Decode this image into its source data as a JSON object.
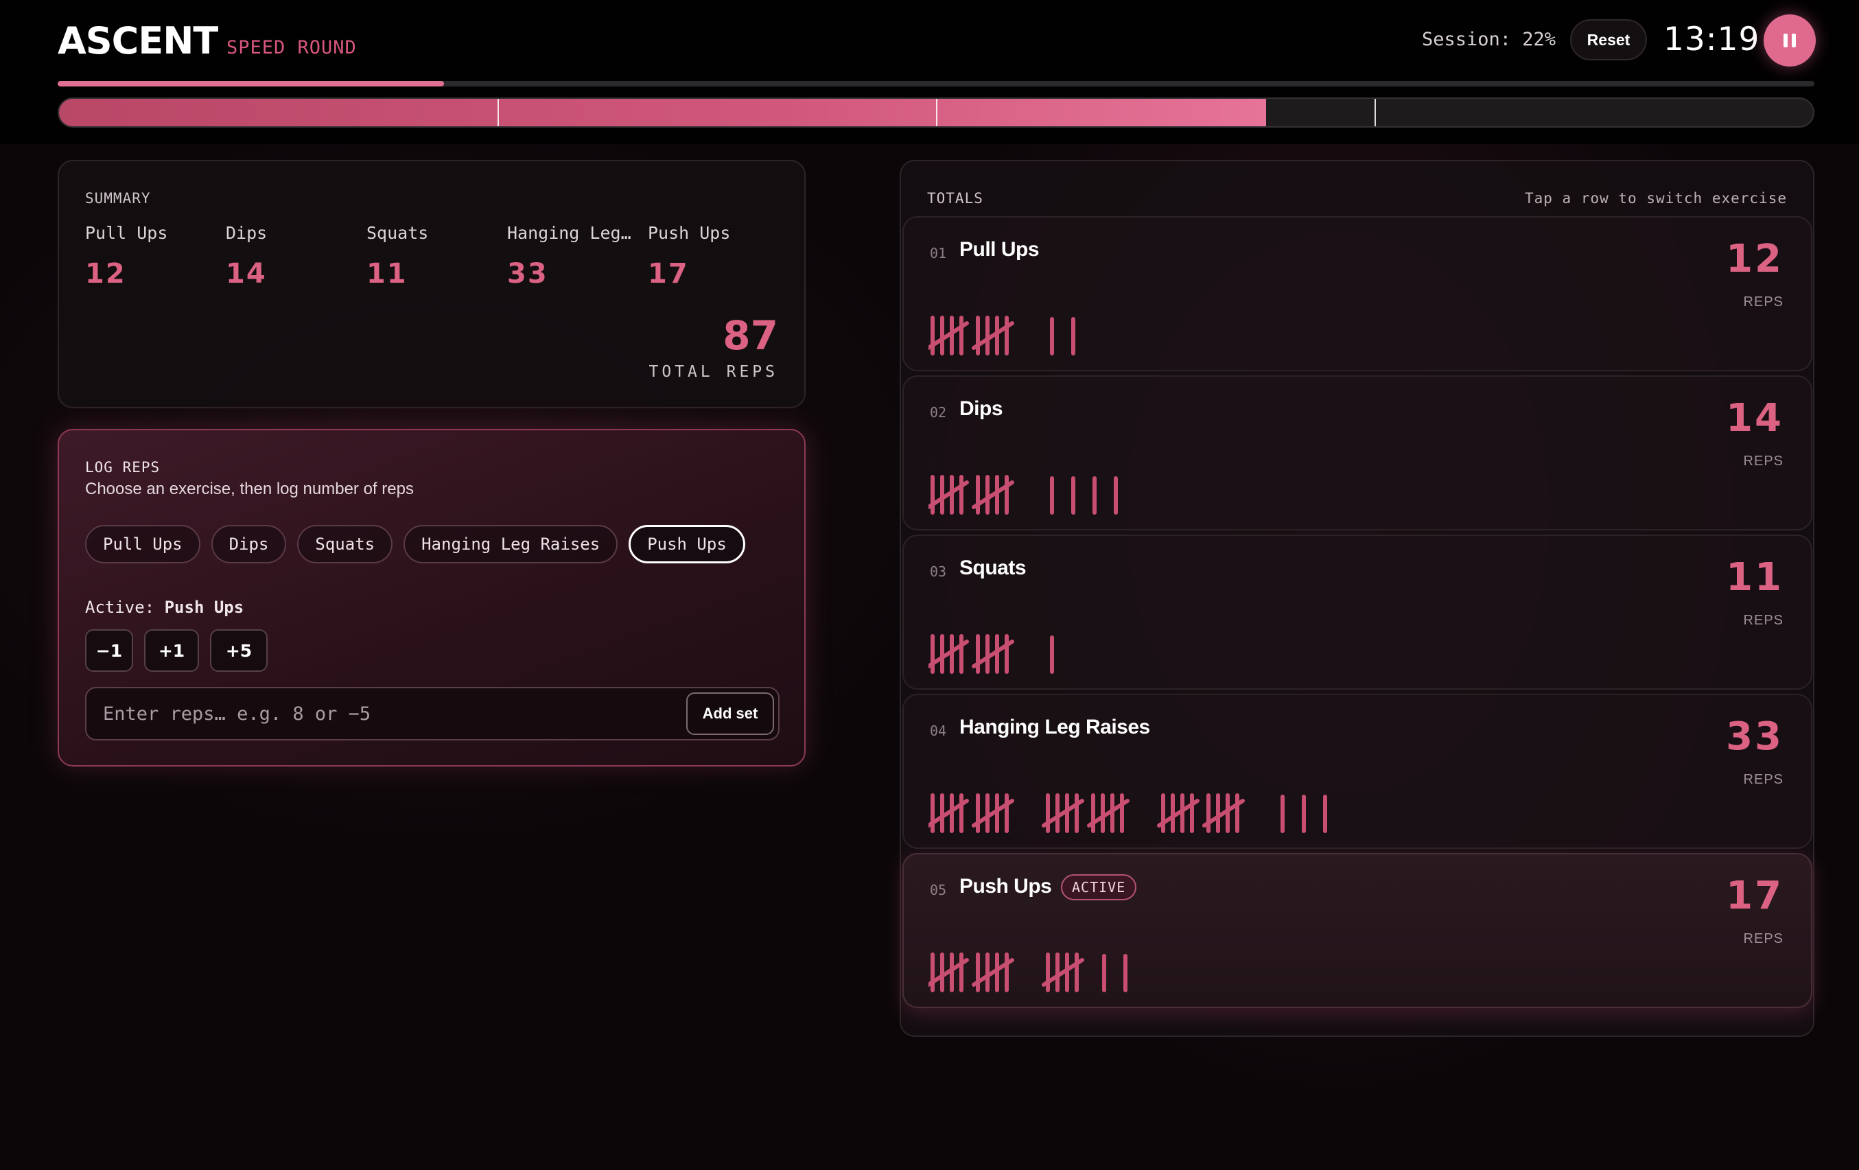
{
  "header": {
    "brand": "ASCENT",
    "mode": "SPEED ROUND",
    "session_text": "Session: 22%",
    "session_progress": 0.22,
    "reset_label": "Reset",
    "clock": "13:19",
    "pause_icon": "pause-icon"
  },
  "segment_bar": {
    "fill_fraction": 0.688,
    "segments": 4,
    "colors": {
      "fill_start": "#b94766",
      "fill_end": "#e67498"
    }
  },
  "summary": {
    "title": "SUMMARY",
    "items": [
      {
        "name": "Pull Ups",
        "value": "12"
      },
      {
        "name": "Dips",
        "value": "14"
      },
      {
        "name": "Squats",
        "value": "11"
      },
      {
        "name": "Hanging Leg …",
        "value": "33"
      },
      {
        "name": "Push Ups",
        "value": "17"
      }
    ],
    "total": "87",
    "total_label": "TOTAL REPS"
  },
  "log": {
    "title": "LOG REPS",
    "subtitle": "Choose an exercise, then log number of reps",
    "pills": [
      "Pull Ups",
      "Dips",
      "Squats",
      "Hanging Leg Raises",
      "Push Ups"
    ],
    "active_pill_index": 4,
    "active_label": "Active:",
    "active_value": "Push Ups",
    "steps": [
      "−1",
      "+1",
      "+5"
    ],
    "input_placeholder": "Enter reps… e.g. 8 or −5",
    "input_value": "",
    "add_label": "Add set"
  },
  "totals": {
    "title": "TOTALS",
    "hint": "Tap a row to switch exercise",
    "reps_label": "REPS",
    "active_badge": "ACTIVE",
    "rows": [
      {
        "num": "01",
        "name": "Pull Ups",
        "count": "12",
        "reps": 12,
        "active": false
      },
      {
        "num": "02",
        "name": "Dips",
        "count": "14",
        "reps": 14,
        "active": false
      },
      {
        "num": "03",
        "name": "Squats",
        "count": "11",
        "reps": 11,
        "active": false
      },
      {
        "num": "04",
        "name": "Hanging Leg Raises",
        "count": "33",
        "reps": 33,
        "active": false
      },
      {
        "num": "05",
        "name": "Push Ups",
        "count": "17",
        "reps": 17,
        "active": true
      }
    ]
  },
  "colors": {
    "accent": "#dc6283",
    "tally": "#c94f72",
    "background": "#0b0709"
  }
}
